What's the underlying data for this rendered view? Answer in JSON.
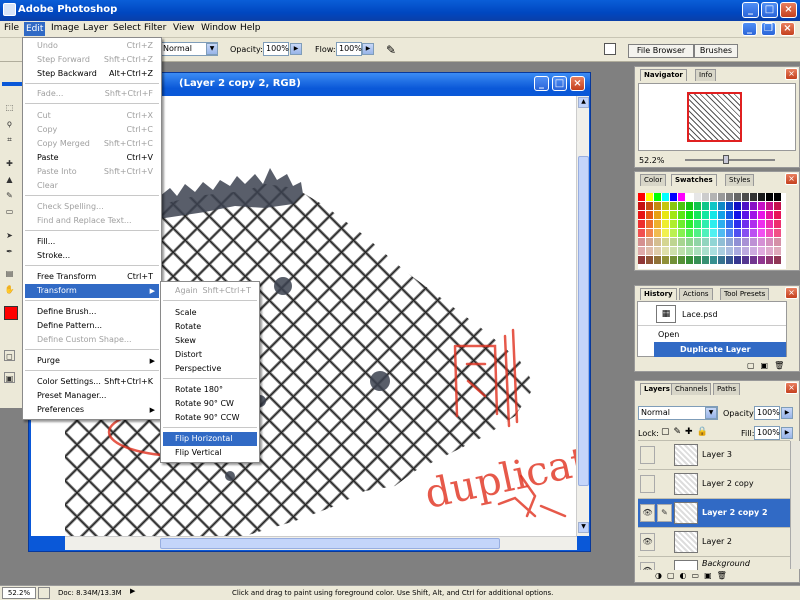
{
  "window": {
    "title": "Adobe Photoshop"
  },
  "menubar": [
    "File",
    "Edit",
    "Image",
    "Layer",
    "Select",
    "Filter",
    "View",
    "Window",
    "Help"
  ],
  "options": {
    "mode_value": "Normal",
    "opacity_label": "Opacity:",
    "opacity_value": "100%",
    "flow_label": "Flow:",
    "flow_value": "100%",
    "tab_file_browser": "File Browser",
    "tab_brushes": "Brushes"
  },
  "document": {
    "title": "(Layer 2 copy 2, RGB)"
  },
  "edit_menu": [
    {
      "label": "Undo",
      "shortcut": "Ctrl+Z",
      "disabled": true
    },
    {
      "label": "Step Forward",
      "shortcut": "Shft+Ctrl+Z",
      "disabled": true
    },
    {
      "label": "Step Backward",
      "shortcut": "Alt+Ctrl+Z",
      "disabled": false
    },
    {
      "label": "Fade...",
      "shortcut": "Shft+Ctrl+F",
      "disabled": true
    },
    {
      "label": "Cut",
      "shortcut": "Ctrl+X",
      "disabled": true
    },
    {
      "label": "Copy",
      "shortcut": "Ctrl+C",
      "disabled": true
    },
    {
      "label": "Copy Merged",
      "shortcut": "Shft+Ctrl+C",
      "disabled": true
    },
    {
      "label": "Paste",
      "shortcut": "Ctrl+V",
      "disabled": false
    },
    {
      "label": "Paste Into",
      "shortcut": "Shft+Ctrl+V",
      "disabled": true
    },
    {
      "label": "Clear",
      "shortcut": "",
      "disabled": true
    },
    {
      "label": "Check Spelling...",
      "shortcut": "",
      "disabled": true
    },
    {
      "label": "Find and Replace Text...",
      "shortcut": "",
      "disabled": true
    },
    {
      "label": "Fill...",
      "shortcut": "",
      "disabled": false
    },
    {
      "label": "Stroke...",
      "shortcut": "",
      "disabled": false
    },
    {
      "label": "Free Transform",
      "shortcut": "Ctrl+T",
      "disabled": false
    },
    {
      "label": "Transform",
      "shortcut": "",
      "disabled": false
    },
    {
      "label": "Define Brush...",
      "shortcut": "",
      "disabled": false
    },
    {
      "label": "Define Pattern...",
      "shortcut": "",
      "disabled": false
    },
    {
      "label": "Define Custom Shape...",
      "shortcut": "",
      "disabled": true
    },
    {
      "label": "Purge",
      "shortcut": "",
      "disabled": false
    },
    {
      "label": "Color Settings...",
      "shortcut": "Shft+Ctrl+K",
      "disabled": false
    },
    {
      "label": "Preset Manager...",
      "shortcut": "",
      "disabled": false
    },
    {
      "label": "Preferences",
      "shortcut": "",
      "disabled": false
    }
  ],
  "transform_menu": [
    "Again",
    "Shft+Ctrl+T",
    "Scale",
    "Rotate",
    "Skew",
    "Distort",
    "Perspective",
    "Rotate 180°",
    "Rotate 90° CW",
    "Rotate 90° CCW",
    "Flip Horizontal",
    "Flip Vertical"
  ],
  "navigator": {
    "tab1": "Navigator",
    "tab2": "Info",
    "zoom": "52.2%"
  },
  "swatches": {
    "tab1": "Color",
    "tab2": "Swatches",
    "tab3": "Styles"
  },
  "history": {
    "tab1": "History",
    "tab2": "Actions",
    "tab3": "Tool Presets",
    "snapshot": "Lace.psd",
    "items": [
      "Open",
      "Duplicate Layer"
    ]
  },
  "layers": {
    "tab1": "Layers",
    "tab2": "Channels",
    "tab3": "Paths",
    "blend": "Normal",
    "opacity_label": "Opacity:",
    "opacity": "100%",
    "lock_label": "Lock:",
    "fill_label": "Fill:",
    "fill": "100%",
    "items": [
      "Layer 3",
      "Layer 2 copy",
      "Layer 2 copy 2",
      "Layer 2",
      "Background"
    ]
  },
  "status": {
    "zoom": "52.2%",
    "doc": "Doc: 8.34M/13.3M",
    "hint": "Click and drag to paint using foreground color.  Use Shift, Alt, and Ctrl for additional options."
  },
  "colors": {
    "accent": "#316ac5",
    "title": "#0a58d8",
    "annotation": "#e0301e"
  },
  "annotation_text": "duplicate"
}
